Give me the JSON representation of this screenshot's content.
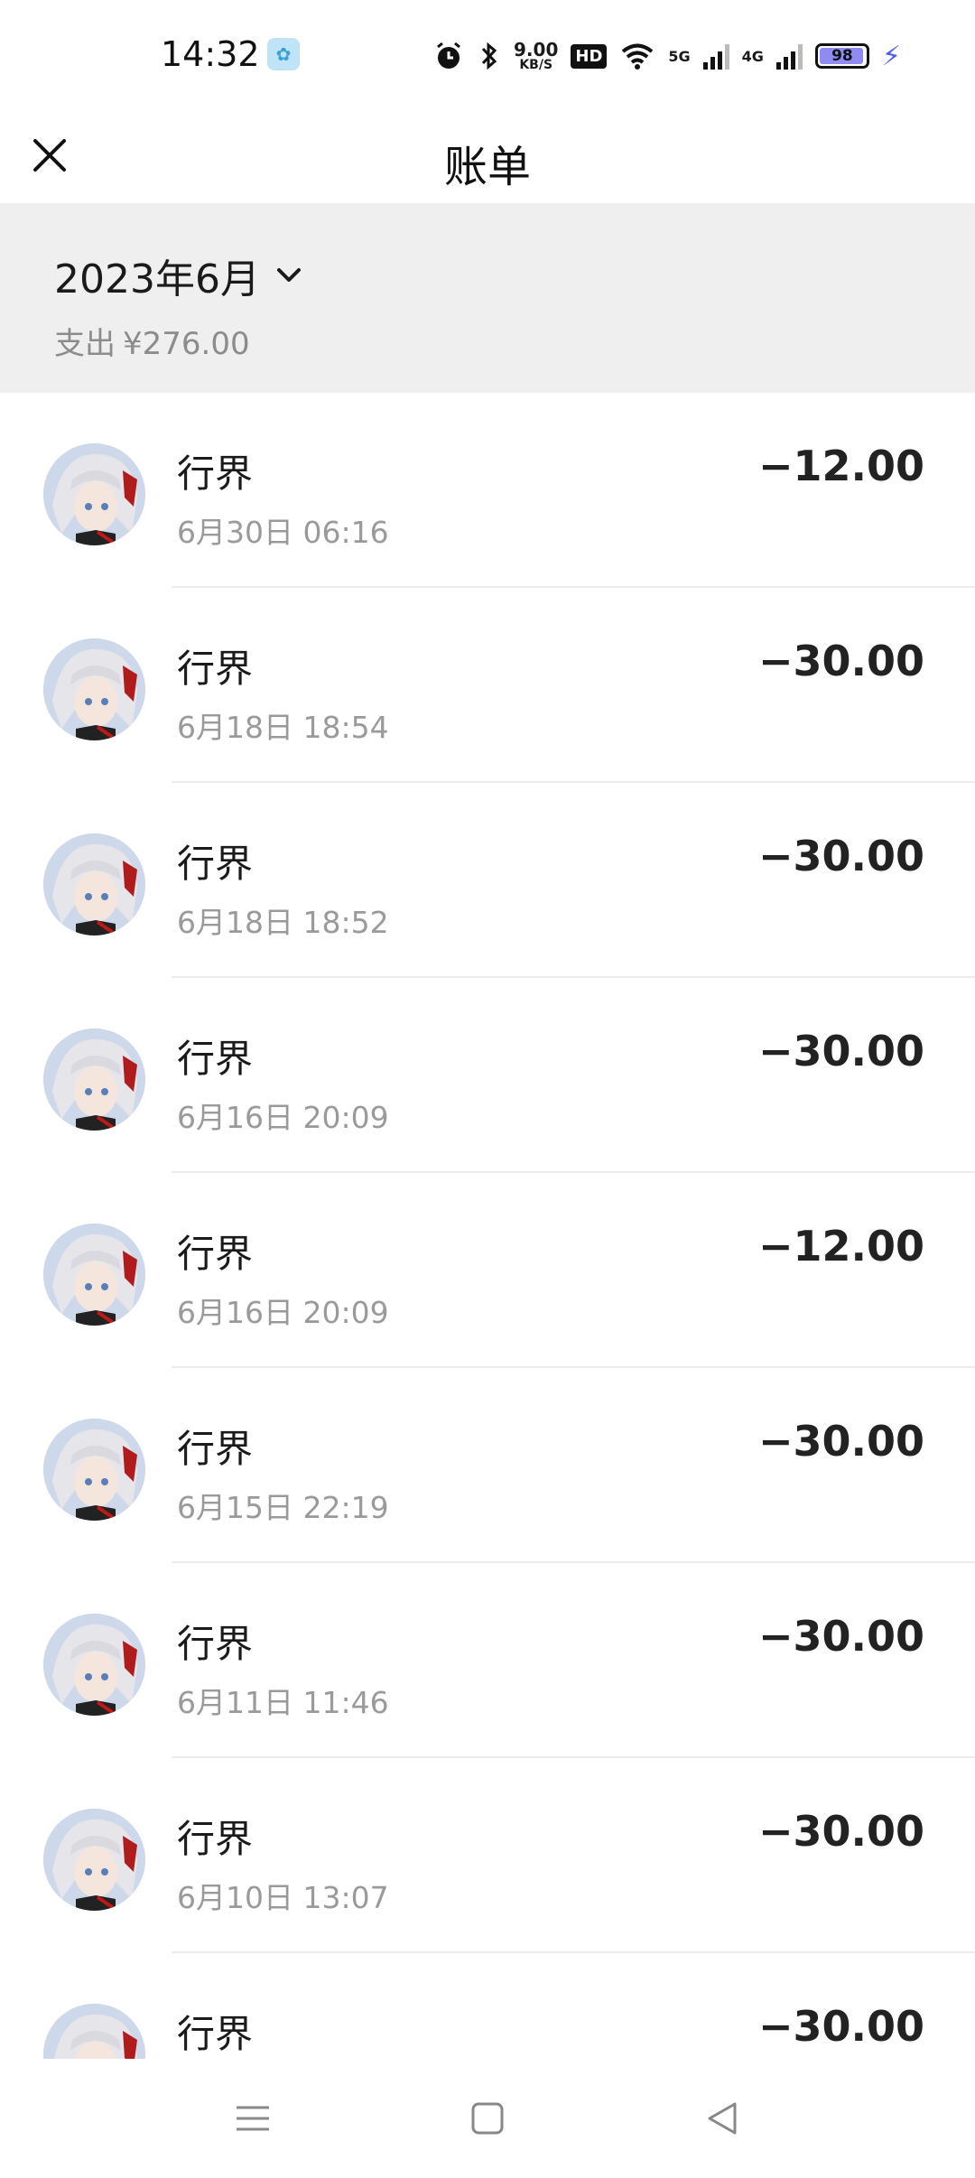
{
  "status_bar": {
    "time": "14:32",
    "speed_value": "9.00",
    "speed_unit": "KB/S",
    "hd_label": "HD",
    "net_5g": "5G",
    "net_4g": "4G",
    "battery_level": "98",
    "icons": [
      "alarm-icon",
      "bluetooth-icon",
      "wifi-icon",
      "signal-icon",
      "battery-icon",
      "charging-icon"
    ]
  },
  "header": {
    "title": "账单"
  },
  "summary": {
    "month": "2023年6月",
    "spent_label": "支出",
    "spent_amount": "¥276.00"
  },
  "transactions": [
    {
      "name": "行界",
      "time": "6月30日 06:16",
      "amount": "−12.00"
    },
    {
      "name": "行界",
      "time": "6月18日 18:54",
      "amount": "−30.00"
    },
    {
      "name": "行界",
      "time": "6月18日 18:52",
      "amount": "−30.00"
    },
    {
      "name": "行界",
      "time": "6月16日 20:09",
      "amount": "−30.00"
    },
    {
      "name": "行界",
      "time": "6月16日 20:09",
      "amount": "−12.00"
    },
    {
      "name": "行界",
      "time": "6月15日 22:19",
      "amount": "−30.00"
    },
    {
      "name": "行界",
      "time": "6月11日 11:46",
      "amount": "−30.00"
    },
    {
      "name": "行界",
      "time": "6月10日 13:07",
      "amount": "−30.00"
    },
    {
      "name": "行界",
      "time": "",
      "amount": "−30.00"
    }
  ],
  "colors": {
    "summary_bg": "#efefef",
    "secondary_text": "#9a9a9a",
    "battery_fill": "#8e8cf2",
    "charging": "#4b5bf5"
  }
}
